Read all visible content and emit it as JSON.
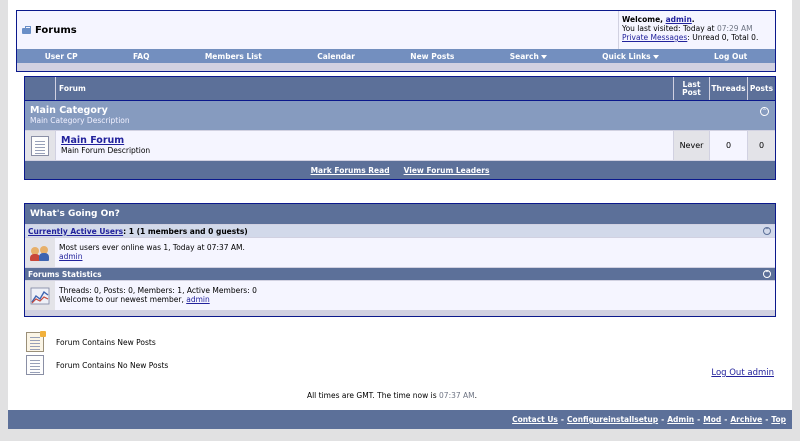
{
  "header": {
    "title": "Forums",
    "welcome_prefix": "Welcome, ",
    "username": "admin",
    "last_visited_prefix": "You last visited: Today at ",
    "last_visited_time": "07:29 AM",
    "pm_link": "Private Messages",
    "pm_stats": ": Unread 0, Total 0."
  },
  "navbar": {
    "items": [
      "User CP",
      "FAQ",
      "Members List",
      "Calendar",
      "New Posts",
      "Search",
      "Quick Links",
      "Log Out"
    ]
  },
  "forum_table": {
    "columns": {
      "forum": "Forum",
      "last_post": "Last Post",
      "threads": "Threads",
      "posts": "Posts"
    },
    "category": {
      "title": "Main Category",
      "description": "Main Category Description"
    },
    "forums": [
      {
        "name": "Main Forum",
        "description": "Main Forum Description",
        "last_post": "Never",
        "threads": "0",
        "posts": "0"
      }
    ],
    "footer_links": [
      "Mark Forums Read",
      "View Forum Leaders"
    ]
  },
  "whats_going_on": {
    "title": "What's Going On?",
    "active_users": {
      "link": "Currently Active Users",
      "summary": ": 1 (1 members and 0 guests)",
      "record": "Most users ever online was 1, Today at 07:37 AM.",
      "user": "admin"
    },
    "statistics": {
      "title": "Forums Statistics",
      "line": "Threads: 0, Posts: 0, Members: 1, Active Members: 0",
      "newest_prefix": "Welcome to our newest member, ",
      "newest_member": "admin"
    }
  },
  "legend": {
    "new_posts": "Forum Contains New Posts",
    "no_new_posts": "Forum Contains No New Posts"
  },
  "logout_admin": "Log Out admin",
  "time_notice": {
    "prefix": "All times are GMT. The time now is ",
    "time": "07:37 AM",
    "suffix": "."
  },
  "footer": {
    "links": [
      "Contact Us",
      "Configureinstallsetup",
      "Admin",
      "Mod",
      "Archive",
      "Top"
    ]
  }
}
